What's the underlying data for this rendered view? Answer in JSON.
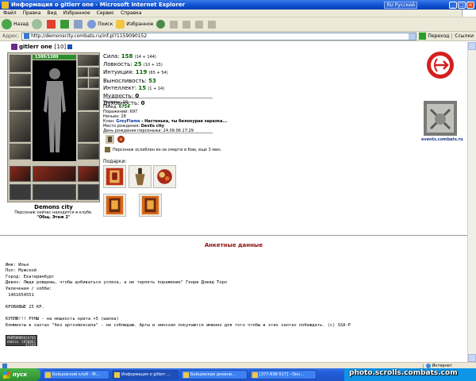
{
  "window": {
    "title": "Информация о gitlerr one - Microsoft Internet Explorer",
    "lang_indicator": "RU Русский"
  },
  "menu": [
    "Файл",
    "Правка",
    "Вид",
    "Избранное",
    "Сервис",
    "Справка"
  ],
  "toolbar": {
    "back": "Назад",
    "search": "Поиск",
    "favorites": "Избранное"
  },
  "address": {
    "label": "Адрес:",
    "url": "http://demonscity.combats.ru/inf.pl?1159090152",
    "go": "Переход",
    "links": "Ссылки"
  },
  "character": {
    "name": "gitlerr one",
    "level": "[10]",
    "hp": "1389/1389",
    "location": "Demons city",
    "status_line1": "Персонаж сейчас находится в клубе.",
    "status_line2": "\"Общ. Этаж 2\""
  },
  "stats": [
    {
      "label": "Сила:",
      "value": "158",
      "bonus": "(14 + 144)"
    },
    {
      "label": "Ловкость:",
      "value": "25",
      "bonus": "(10 + 15)"
    },
    {
      "label": "Интуиция:",
      "value": "119",
      "bonus": "(65 + 54)"
    },
    {
      "label": "Выносливость:",
      "value": "53",
      "bonus": ""
    },
    {
      "label": "Интеллект:",
      "value": "15",
      "bonus": "(1 + 14)"
    },
    {
      "label": "Мудрость:",
      "value": "0",
      "bonus": ""
    },
    {
      "label": "Духовность:",
      "value": "0",
      "bonus": ""
    }
  ],
  "info": {
    "level": "Уровень: 10",
    "wins_label": "Побед:",
    "wins": "6754",
    "losses": "Поражений: 697",
    "draws": "Ничьих: 28",
    "clan_label": "Клан:",
    "clan": "GreyFlame",
    "clan_motto": "- Настенька, ты белокурая заразка...",
    "birthplace_label": "Место рождения:",
    "birthplace": "Devils city",
    "birthday": "День рождения персонажа: 24.09.06 17:29",
    "weakness": "Персонаж ослаблен из-за смерти в бою, еще 3 мин."
  },
  "gifts_label": "Подарки:",
  "emblem_caption": "events.combats.ru",
  "anketa": {
    "title": "Анкетные данные",
    "name": "Имя: Илья",
    "sex": "Пол: Мужской",
    "city": "Город: Екатеринбург",
    "motto": "Девиз: Люди рождены, чтобы добиваться успеха, а не терпеть поражение\" Генри Дэвид Торо",
    "hobbies": "Увлечения / хобби:",
    "hobby_value": " 1461654551",
    "blank": " ",
    "krov": "КРОВАВЫЕ 25 КР.",
    "blank2": " ",
    "buy": "КУПЛЮ!!! РУНЫ - на мощность крита +5 (шапка)",
    "comments": "Комменты в хаотах \"без артоэмоксила\" - не соблюдаю. Арты и эмоххил покупаются именно для того чтобы в этих хаотах побеждать. (c) SSA-P"
  },
  "counter": {
    "left1": "РЕЙТИНГ",
    "left2": "mail.ru",
    "right1": "19616785",
    "right2": "1858861",
    "right3": "47100"
  },
  "statusbar": {
    "zone": "Интернет"
  },
  "taskbar": {
    "start": "пуск",
    "tasks": [
      "Бойцовский клуб - M...",
      "Информация о gitlerr ...",
      "Бойцовские дневни...",
      "[377-698-517] - Окн..."
    ]
  },
  "watermark": "photo.scrolls.combats.com",
  "colors": {
    "stat_value": "#006600",
    "anketa_title": "#8a0f0f",
    "hp_bar": "#2c8f2c"
  }
}
